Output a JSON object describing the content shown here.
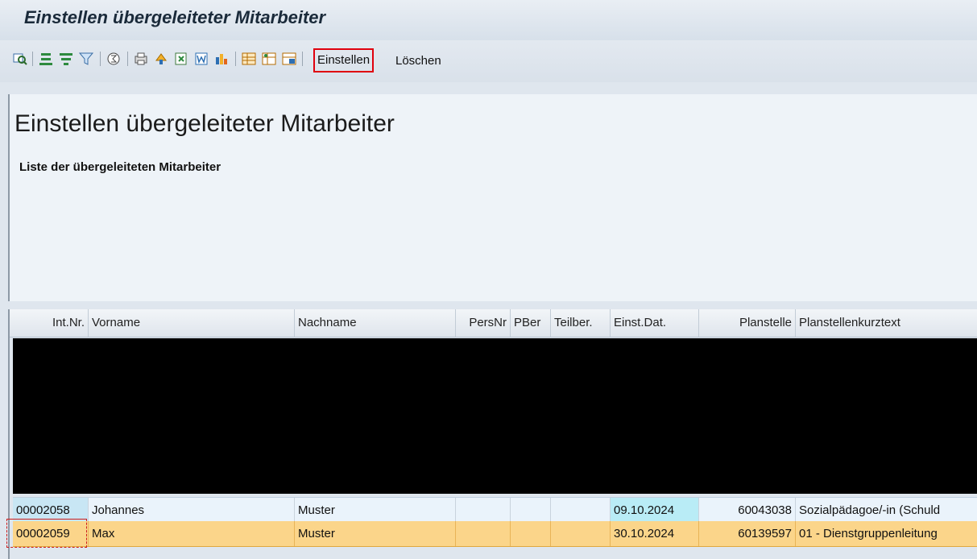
{
  "window": {
    "title": "Einstellen übergeleiteter Mitarbeiter"
  },
  "toolbar": {
    "icons": [
      "details-icon",
      "sort-ascending-icon",
      "sort-descending-icon",
      "filter-icon",
      "total-icon",
      "print-icon",
      "export-icon",
      "spreadsheet-icon",
      "word-icon",
      "graphic-icon",
      "layout-icon",
      "change-layout-icon",
      "save-layout-icon"
    ],
    "buttons": {
      "einstellen": "Einstellen",
      "loeschen": "Löschen"
    }
  },
  "header": {
    "title": "Einstellen übergeleiteter Mitarbeiter",
    "subtitle": "Liste der übergeleiteten Mitarbeiter"
  },
  "table": {
    "columns": [
      "Int.Nr.",
      "Vorname",
      "Nachname",
      "PersNr",
      "PBer",
      "Teilber.",
      "Einst.Dat.",
      "Planstelle",
      "Planstellenkurztext"
    ],
    "rows": [
      {
        "intnr": "00002058",
        "vorname": "Johannes",
        "nachname": "Muster",
        "persnr": "",
        "pber": "",
        "teilber": "",
        "einstdat": "09.10.2024",
        "planstelle": "60043038",
        "kurztext": "Sozialpädagoe/-in (Schuld"
      },
      {
        "intnr": "00002059",
        "vorname": "Max",
        "nachname": "Muster",
        "persnr": "",
        "pber": "",
        "teilber": "",
        "einstdat": "30.10.2024",
        "planstelle": "60139597",
        "kurztext": "01 - Dienstgruppenleitung"
      }
    ],
    "selected_row": 1
  },
  "colors": {
    "selected_row": "#fbd58a",
    "highlight_cell": "#b9ecf6",
    "focus": "#e0000d"
  }
}
